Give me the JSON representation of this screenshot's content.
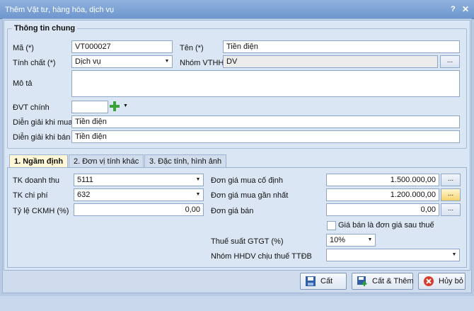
{
  "window": {
    "title": "Thêm Vật tư, hàng hóa, dịch vụ",
    "help": "?",
    "close": "✕"
  },
  "general": {
    "section_title": "Thông tin chung",
    "ma_label": "Mã (*)",
    "ma_value": "VT000027",
    "ten_label": "Tên (*)",
    "ten_value": "Tiền điện",
    "tinhchat_label": "Tính chất (*)",
    "tinhchat_value": "Dịch vụ",
    "nhom_label": "Nhóm VTHH",
    "nhom_value": "DV",
    "mota_label": "Mô tả",
    "mota_value": "",
    "dvt_label": "ĐVT chính",
    "dvt_value": "",
    "dgmua_label": "Diễn giải khi mua",
    "dgmua_value": "Tiền điện",
    "dgban_label": "Diễn giải khi bán",
    "dgban_value": "Tiền điện",
    "ellipsis": "..."
  },
  "tabs": [
    {
      "label": "1. Ngầm định"
    },
    {
      "label": "2. Đơn vị tính khác"
    },
    {
      "label": "3. Đặc tính, hình ảnh"
    }
  ],
  "defaults": {
    "tkdt_label": "TK doanh thu",
    "tkdt_value": "5111",
    "tkcp_label": "TK chi phí",
    "tkcp_value": "632",
    "tyle_label": "Tỷ lệ CKMH (%)",
    "tyle_value": "0,00",
    "dgmcd_label": "Đơn giá mua cố định",
    "dgmcd_value": "1.500.000,00",
    "dgmgn_label": "Đơn giá mua gần nhất",
    "dgmgn_value": "1.200.000,00",
    "dgb_label": "Đơn giá bán",
    "dgb_value": "0,00",
    "gbsau_label": "Giá bán là đơn giá sau thuế",
    "thue_label": "Thuế suất GTGT (%)",
    "thue_value": "10%",
    "nhomhhdv_label": "Nhóm HHDV chịu thuế TTĐB",
    "nhomhhdv_value": ""
  },
  "buttons": {
    "cat": "Cất",
    "cat_them": "Cất & Thêm",
    "huy": "Hủy bỏ"
  }
}
